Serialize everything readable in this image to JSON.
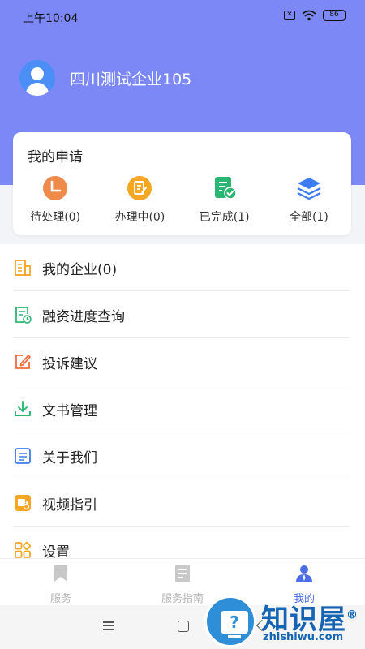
{
  "status_bar": {
    "time": "上午10:04",
    "battery": "86"
  },
  "profile": {
    "company_name": "四川测试企业105"
  },
  "applications": {
    "title": "我的申请",
    "items": [
      {
        "label": "待处理(0)",
        "icon": "clock-icon",
        "color": "#f08a4b"
      },
      {
        "label": "办理中(0)",
        "icon": "edit-document-icon",
        "color": "#f5a623"
      },
      {
        "label": "已完成(1)",
        "icon": "document-check-icon",
        "color": "#2bb673"
      },
      {
        "label": "全部(1)",
        "icon": "layers-icon",
        "color": "#3d7cf0"
      }
    ]
  },
  "menu": [
    {
      "label": "我的企业(0)",
      "icon": "building-icon",
      "color": "#f5a623"
    },
    {
      "label": "融资进度查询",
      "icon": "document-clock-icon",
      "color": "#2bb673"
    },
    {
      "label": "投诉建议",
      "icon": "pencil-square-icon",
      "color": "#f06a3c"
    },
    {
      "label": "文书管理",
      "icon": "download-icon",
      "color": "#2bb673"
    },
    {
      "label": "关于我们",
      "icon": "list-document-icon",
      "color": "#3d7cf0"
    },
    {
      "label": "视频指引",
      "icon": "video-icon",
      "color": "#f5a623"
    },
    {
      "label": "设置",
      "icon": "grid-settings-icon",
      "color": "#f5a623"
    }
  ],
  "tabs": [
    {
      "label": "服务",
      "icon": "bookmark-icon",
      "active": false
    },
    {
      "label": "服务指南",
      "icon": "guide-document-icon",
      "active": false
    },
    {
      "label": "我的",
      "icon": "user-icon",
      "active": true
    }
  ],
  "watermark": {
    "title": "知识屋",
    "registered": "®",
    "domain": "zhishiwu.com",
    "symbol": "?"
  },
  "colors": {
    "primary": "#7b88f5",
    "accent": "#4b6ee8",
    "avatar": "#4b8ef5"
  }
}
